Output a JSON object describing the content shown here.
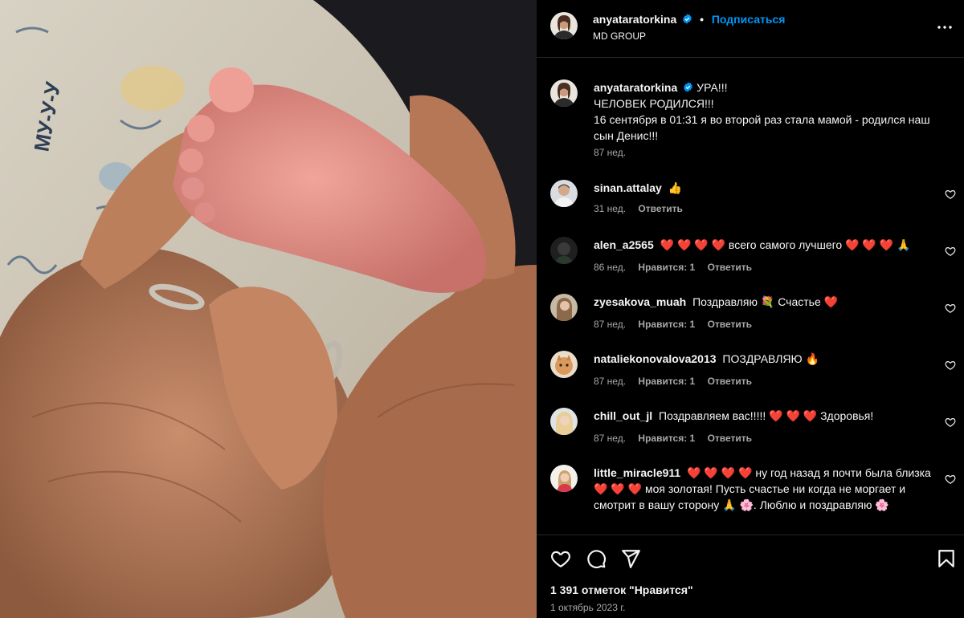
{
  "post": {
    "author": "anyataratorkina",
    "follow_label": "Подписаться",
    "location": "MD GROUP",
    "caption_lines": [
      "УРА!!!",
      "ЧЕЛОВЕК РОДИЛСЯ!!!",
      "16 сентября в 01:31 я во второй раз стала мамой - родился наш сын Денис!!!"
    ],
    "caption_time": "87 нед.",
    "likes": "1 391 отметок \"Нравится\"",
    "date": "1 октябрь 2023 г.",
    "photo_text": "МУ-У-У"
  },
  "comments": [
    {
      "user": "sinan.attalay",
      "text": "👍",
      "time": "31 нед.",
      "likes": "",
      "reply": "Ответить"
    },
    {
      "user": "alen_a2565",
      "text": "❤️ ❤️ ❤️ ❤️ всего самого лучшего ❤️ ❤️ ❤️ 🙏",
      "time": "86 нед.",
      "likes": "Нравится: 1",
      "reply": "Ответить"
    },
    {
      "user": "zyesakova_muah",
      "text": "Поздравляю 💐 Счастье ❤️",
      "time": "87 нед.",
      "likes": "Нравится: 1",
      "reply": "Ответить"
    },
    {
      "user": "nataliekonovalova2013",
      "text": "ПОЗДРАВЛЯЮ 🔥",
      "time": "87 нед.",
      "likes": "Нравится: 1",
      "reply": "Ответить"
    },
    {
      "user": "chill_out_jl",
      "text": "Поздравляем вас!!!!! ❤️ ❤️ ❤️ Здоровья!",
      "time": "87 нед.",
      "likes": "Нравится: 1",
      "reply": "Ответить"
    },
    {
      "user": "little_miracle911",
      "text": "❤️ ❤️ ❤️ ❤️ ну год назад я почти была близка ❤️ ❤️ ❤️ моя золотая! Пусть счастье ни когда не моргает и смотрит в вашу сторону 🙏 🌸. Люблю и поздравляю 🌸",
      "time": "",
      "likes": "",
      "reply": ""
    }
  ],
  "icons": {
    "more": "more-horizontal-icon",
    "like": "heart-icon",
    "comment": "comment-icon",
    "share": "send-icon",
    "save": "bookmark-icon"
  },
  "colors": {
    "link": "#0095f6",
    "verified": "#0095f6",
    "muted": "#a8a8a8"
  }
}
